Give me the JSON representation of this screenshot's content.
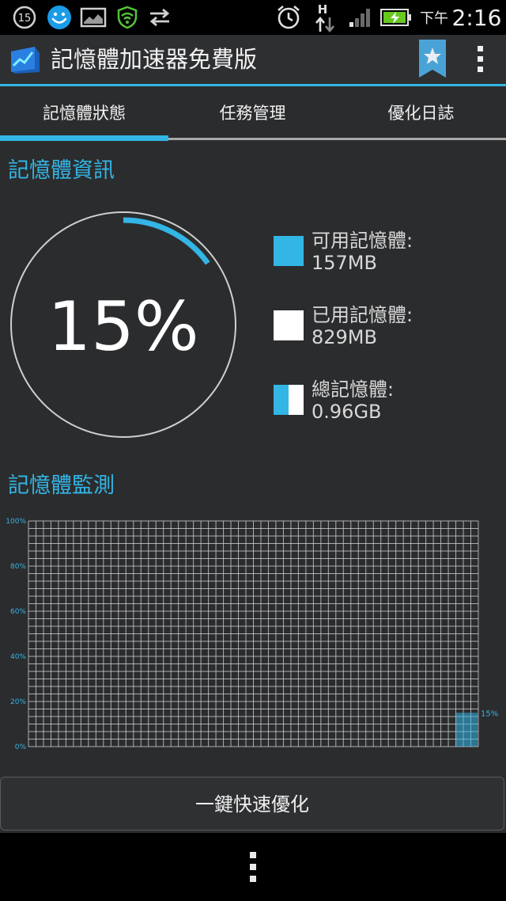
{
  "status_bar": {
    "notification_count": "15",
    "network_type": "H",
    "time_period": "下午",
    "time": "2:16"
  },
  "app_bar": {
    "title": "記憶體加速器免費版"
  },
  "tabs": [
    {
      "label": "記憶體狀態",
      "selected": true
    },
    {
      "label": "任務管理",
      "selected": false
    },
    {
      "label": "優化日誌",
      "selected": false
    }
  ],
  "memory_info": {
    "section_title": "記憶體資訊",
    "usage_percent_text": "15%",
    "usage_fraction": 0.15,
    "legend": [
      {
        "label": "可用記憶體:",
        "value": "157MB",
        "swatch": "available"
      },
      {
        "label": "已用記憶體:",
        "value": "829MB",
        "swatch": "used"
      },
      {
        "label": "總記憶體:",
        "value": "0.96GB",
        "swatch": "total"
      }
    ]
  },
  "memory_monitor": {
    "section_title": "記憶體監測",
    "y_ticks": [
      "100%",
      "80%",
      "60%",
      "40%",
      "20%",
      "0%"
    ],
    "current_label": "15%",
    "current_value": 15
  },
  "optimize_button": {
    "label": "一鍵快速優化"
  },
  "colors": {
    "accent": "#33b5e5",
    "background": "#2b2c2e",
    "grid": "#d8d8d8"
  },
  "chart_data": {
    "type": "area",
    "y_ticks": [
      "100%",
      "80%",
      "60%",
      "40%",
      "20%",
      "0%"
    ],
    "ylim": [
      0,
      100
    ],
    "series": [
      {
        "values": [
          15
        ]
      }
    ],
    "current_label": "15%",
    "grid": true
  }
}
